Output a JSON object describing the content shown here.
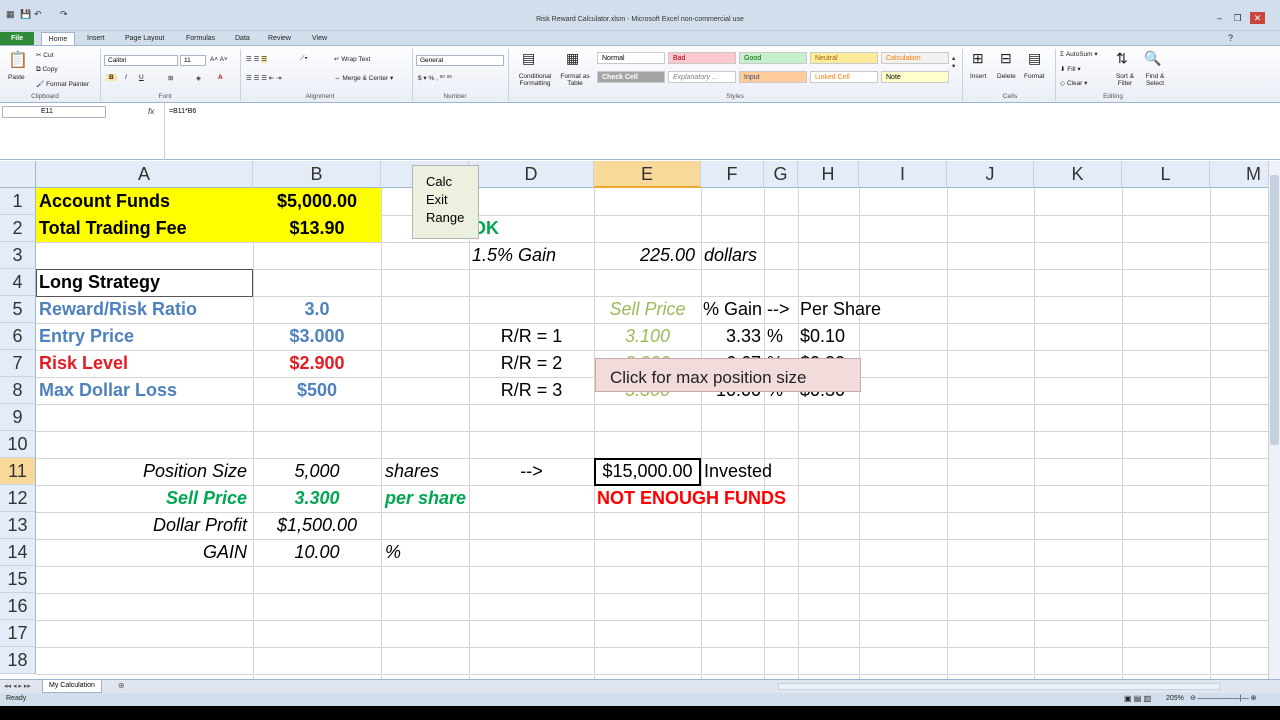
{
  "app": {
    "title": "Risk Reward Calculator.xlsm - Microsoft Excel non-commercial use"
  },
  "tabs": [
    "File",
    "Home",
    "Insert",
    "Page Layout",
    "Formulas",
    "Data",
    "Review",
    "View"
  ],
  "ribbon": {
    "clipboard": {
      "paste": "Paste",
      "cut": "Cut",
      "copy": "Copy",
      "format_painter": "Format Painter",
      "group": "Clipboard"
    },
    "font": {
      "name": "Calibri",
      "size": "11",
      "group": "Font"
    },
    "alignment": {
      "wrap": "Wrap Text",
      "merge": "Merge & Center",
      "group": "Alignment"
    },
    "number": {
      "format": "General",
      "group": "Number"
    },
    "styles": {
      "cond": "Conditional Formatting",
      "table": "Format as Table",
      "group": "Styles",
      "cells": [
        {
          "label": "Normal",
          "bg": "#ffffff",
          "fg": "#000000"
        },
        {
          "label": "Bad",
          "bg": "#ffc7ce",
          "fg": "#9c0006"
        },
        {
          "label": "Good",
          "bg": "#c6efce",
          "fg": "#006100"
        },
        {
          "label": "Neutral",
          "bg": "#ffeb9c",
          "fg": "#9c6500"
        },
        {
          "label": "Calculation",
          "bg": "#f2f2f2",
          "fg": "#fa7d00"
        },
        {
          "label": "Check Cell",
          "bg": "#a5a5a5",
          "fg": "#ffffff"
        },
        {
          "label": "Explanatory ...",
          "bg": "#ffffff",
          "fg": "#7f7f7f"
        },
        {
          "label": "Input",
          "bg": "#ffcc99",
          "fg": "#3f3f76"
        },
        {
          "label": "Linked Cell",
          "bg": "#ffffff",
          "fg": "#fa7d00"
        },
        {
          "label": "Note",
          "bg": "#ffffcc",
          "fg": "#000000"
        }
      ]
    },
    "cells": {
      "insert": "Insert",
      "delete": "Delete",
      "format": "Format",
      "group": "Cells"
    },
    "editing": {
      "autosum": "AutoSum",
      "fill": "Fill",
      "clear": "Clear",
      "sort": "Sort & Filter",
      "find": "Find & Select",
      "group": "Editing"
    }
  },
  "formula_bar": {
    "name_box": "E11",
    "fx": "fx",
    "formula": "=B11*B6"
  },
  "columns": [
    "A",
    "B",
    "C",
    "D",
    "E",
    "F",
    "G",
    "H",
    "I",
    "J",
    "K",
    "L",
    "M"
  ],
  "rows": [
    "1",
    "2",
    "3",
    "4",
    "5",
    "6",
    "7",
    "8",
    "9",
    "10",
    "11",
    "12",
    "13",
    "14",
    "15",
    "16",
    "17",
    "18"
  ],
  "cells": {
    "A1": "Account Funds",
    "B1": "$5,000.00",
    "A2": "Total Trading Fee",
    "B2": "$13.90",
    "D2": "OK",
    "D3": "1.5% Gain",
    "E3": "225.00",
    "F3": "dollars",
    "A4": "Long Strategy",
    "A5": "Reward/Risk Ratio",
    "B5": "3.0",
    "E5": "Sell Price",
    "F5": "% Gain -->",
    "H5": "Per Share",
    "A6": "Entry Price",
    "B6": "$3.000",
    "D6": "R/R = 1",
    "E6": "3.100",
    "F6": "3.33",
    "G6": "%",
    "H6": "$0.10",
    "A7": "Risk Level",
    "B7": "$2.900",
    "D7": "R/R = 2",
    "E7": "3.200",
    "F7": "6.67",
    "G7": "%",
    "H7": "$0.20",
    "A8": "Max Dollar Loss",
    "B8": "$500",
    "D8": "R/R = 3",
    "E8": "3.300",
    "F8": "10.00",
    "G8": "%",
    "H8": "$0.30",
    "A11": "Position Size",
    "B11": "5,000",
    "C11": "shares",
    "D11": "-->",
    "E11": "$15,000.00",
    "F11": "Invested",
    "A12": "Sell Price",
    "B12": "3.300",
    "C12": "per share",
    "E12": "NOT ENOUGH FUNDS",
    "A13": "Dollar Profit",
    "B13": "$1,500.00",
    "A14": "GAIN",
    "B14": "10.00",
    "C14": "%"
  },
  "buttons": {
    "calc": [
      "Calc",
      "Exit",
      "Range"
    ],
    "max": "Click for max position size"
  },
  "sheet_tab": "My Calculation",
  "status": {
    "ready": "Ready",
    "zoom": "205%"
  }
}
